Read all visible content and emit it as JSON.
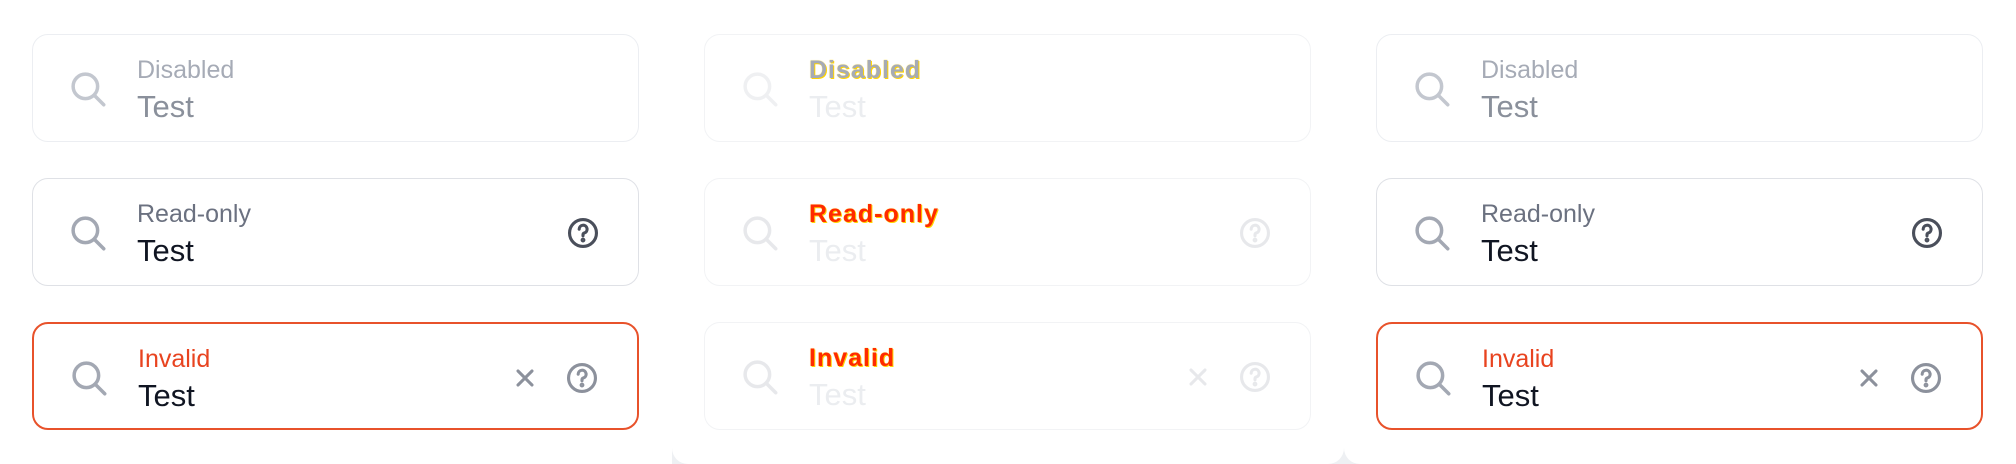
{
  "colors": {
    "border": "#dfe1e6",
    "invalid_border": "#e8522b",
    "invalid_label": "#e8431f",
    "label": "#6b7180",
    "value": "#101522",
    "disabled_label": "#a6abb6",
    "icon": "#a3a8b3"
  },
  "panels": [
    {
      "fields": [
        {
          "label": "Disabled",
          "value": "Test",
          "state": "disabled",
          "icon": "search-icon"
        },
        {
          "label": "Read-only",
          "value": "Test",
          "state": "readonly",
          "icon": "search-icon",
          "trailing": [
            "help-icon"
          ]
        },
        {
          "label": "Invalid",
          "value": "Test",
          "state": "invalid",
          "icon": "search-icon",
          "trailing": [
            "clear-icon",
            "help-icon"
          ]
        }
      ]
    },
    {
      "fields": [
        {
          "label": "Disabled",
          "value": "Test",
          "state": "disabled",
          "icon": "search-icon"
        },
        {
          "label": "Read-only",
          "value": "Test",
          "state": "readonly",
          "icon": "search-icon",
          "trailing": [
            "help-icon"
          ]
        },
        {
          "label": "Invalid",
          "value": "Test",
          "state": "invalid",
          "icon": "search-icon",
          "trailing": [
            "clear-icon",
            "help-icon"
          ]
        }
      ]
    },
    {
      "fields": [
        {
          "label": "Disabled",
          "value": "Test",
          "state": "disabled",
          "icon": "search-icon"
        },
        {
          "label": "Read-only",
          "value": "Test",
          "state": "readonly",
          "icon": "search-icon",
          "trailing": [
            "help-icon"
          ]
        },
        {
          "label": "Invalid",
          "value": "Test",
          "state": "invalid",
          "icon": "search-icon",
          "trailing": [
            "clear-icon",
            "help-icon"
          ]
        }
      ]
    }
  ]
}
